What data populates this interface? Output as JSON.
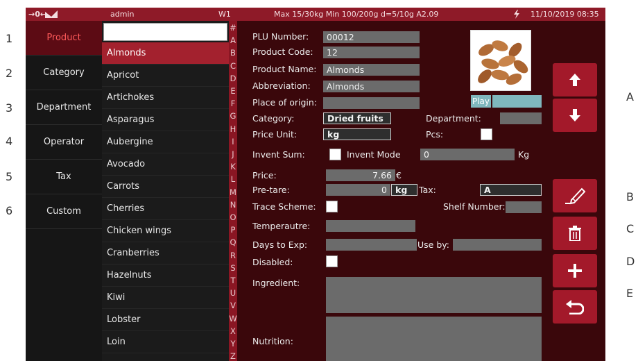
{
  "outer": {
    "row_numbers": [
      "1",
      "2",
      "3",
      "4",
      "5",
      "6"
    ],
    "side_letters": [
      "A",
      "B",
      "C",
      "D",
      "E"
    ]
  },
  "statusbar": {
    "indicator": "→0←",
    "user": "admin",
    "workstation": "W1",
    "scale_info": "Max 15/30kg  Min 100/200g d=5/10g A2.09",
    "datetime": "11/10/2019 08:35",
    "power_icon": "lightning-icon"
  },
  "nav": {
    "items": [
      {
        "label": "Product",
        "active": true
      },
      {
        "label": "Category"
      },
      {
        "label": "Department"
      },
      {
        "label": "Operator"
      },
      {
        "label": "Tax"
      },
      {
        "label": "Custom"
      }
    ]
  },
  "list": {
    "search_value": "",
    "items": [
      "Almonds",
      "Apricot",
      "Artichokes",
      "Asparagus",
      "Aubergine",
      "Avocado",
      "Carrots",
      "Cherries",
      "Chicken wings",
      "Cranberries",
      "Hazelnuts",
      "Kiwi",
      "Lobster",
      "Loin"
    ],
    "active_index": 0
  },
  "alphabet": [
    "#",
    "A",
    "B",
    "C",
    "D",
    "E",
    "F",
    "G",
    "H",
    "I",
    "J",
    "K",
    "L",
    "M",
    "N",
    "O",
    "P",
    "Q",
    "R",
    "S",
    "T",
    "U",
    "V",
    "W",
    "X",
    "Y",
    "Z"
  ],
  "form": {
    "plu_label": "PLU Number:",
    "plu_value": "00012",
    "code_label": "Product Code:",
    "code_value": "12",
    "name_label": "Product Name:",
    "name_value": "Almonds",
    "abbr_label": "Abbreviation:",
    "abbr_value": "Almonds",
    "origin_label": "Place of origin:",
    "origin_value": "",
    "category_label": "Category:",
    "category_value": "Dried fruits",
    "department_label": "Department:",
    "department_value": "",
    "price_unit_label": "Price Unit:",
    "price_unit_value": "kg",
    "pcs_label": "Pcs:",
    "invent_sum_label": "Invent Sum:",
    "invent_mode_label": "Invent Mode",
    "invent_value": "0",
    "invent_unit": "Kg",
    "price_label": "Price:",
    "price_value": "7.66",
    "currency": "€",
    "pretare_label": "Pre-tare:",
    "pretare_value": "0",
    "pretare_unit": "kg",
    "tax_label": "Tax:",
    "tax_value": "A",
    "trace_label": "Trace Scheme:",
    "shelf_label": "Shelf Number:",
    "shelf_value": "",
    "temp_label": "Temperautre:",
    "temp_value": "",
    "days_label": "Days to Exp:",
    "days_value": "",
    "useby_label": "Use by:",
    "useby_value": "",
    "disabled_label": "Disabled:",
    "ingredient_label": "Ingredient:",
    "ingredient_value": "",
    "nutrition_label": "Nutrition:",
    "nutrition_value": "",
    "play_label": "Play",
    "image_icon": "almonds-image"
  },
  "actions": {
    "icons": [
      "arrow-up-icon",
      "arrow-down-icon",
      "edit-icon",
      "trash-icon",
      "plus-icon",
      "undo-icon"
    ]
  },
  "colors": {
    "screen_bg": "#3a070b",
    "accent": "#a3192a",
    "active_list": "#a3212e",
    "statusbar": "#8e1a28"
  }
}
